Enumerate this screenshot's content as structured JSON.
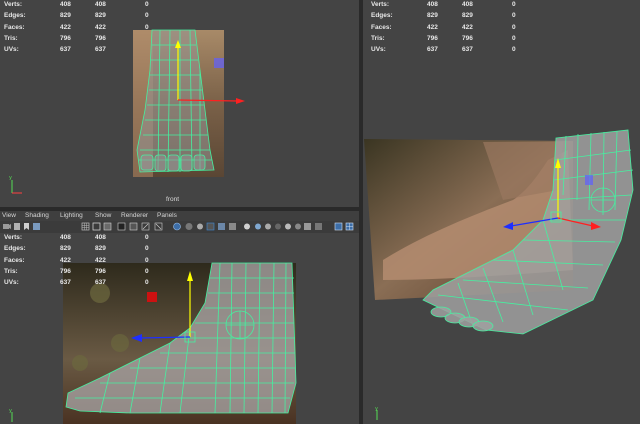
{
  "hud_stats": {
    "rows": [
      {
        "label": "Verts:",
        "a": "408",
        "b": "408",
        "c": "0"
      },
      {
        "label": "Edges:",
        "a": "829",
        "b": "829",
        "c": "0"
      },
      {
        "label": "Faces:",
        "a": "422",
        "a2": "",
        "b": "422",
        "c": "0"
      },
      {
        "label": "Tris:",
        "a": "796",
        "b": "796",
        "c": "0"
      },
      {
        "label": "UVs:",
        "a": "637",
        "b": "637",
        "c": "0"
      }
    ]
  },
  "front_view": {
    "camera_label": "front"
  },
  "panel_menu": {
    "items": [
      "View",
      "Shading",
      "Lighting",
      "Show",
      "Renderer",
      "Panels"
    ]
  },
  "toolbar_icons": [
    "camera-icon",
    "camera-attr-icon",
    "bookmark-icon",
    "image-plane-icon",
    "grid-icon",
    "film-gate-icon",
    "resolution-gate-icon",
    "gate-mask-icon",
    "field-chart-icon",
    "safe-action-icon",
    "safe-title-icon",
    "isolate-icon",
    "xray-icon",
    "xray-joints-icon",
    "wireframe-icon",
    "smooth-shade-icon",
    "textured-icon",
    "lights-icon",
    "shadows-icon",
    "ambient-occlusion-icon",
    "motion-blur-icon",
    "anti-alias-icon",
    "depth-of-field-icon",
    "gamma-icon",
    "exposure-icon",
    "single-pane-icon",
    "four-pane-icon"
  ],
  "colors": {
    "viewport_bg": "#444444",
    "wireframe": "#46f0a0",
    "axis_x": "#ff2020",
    "axis_y": "#ffff00",
    "axis_z": "#1e2fff"
  }
}
